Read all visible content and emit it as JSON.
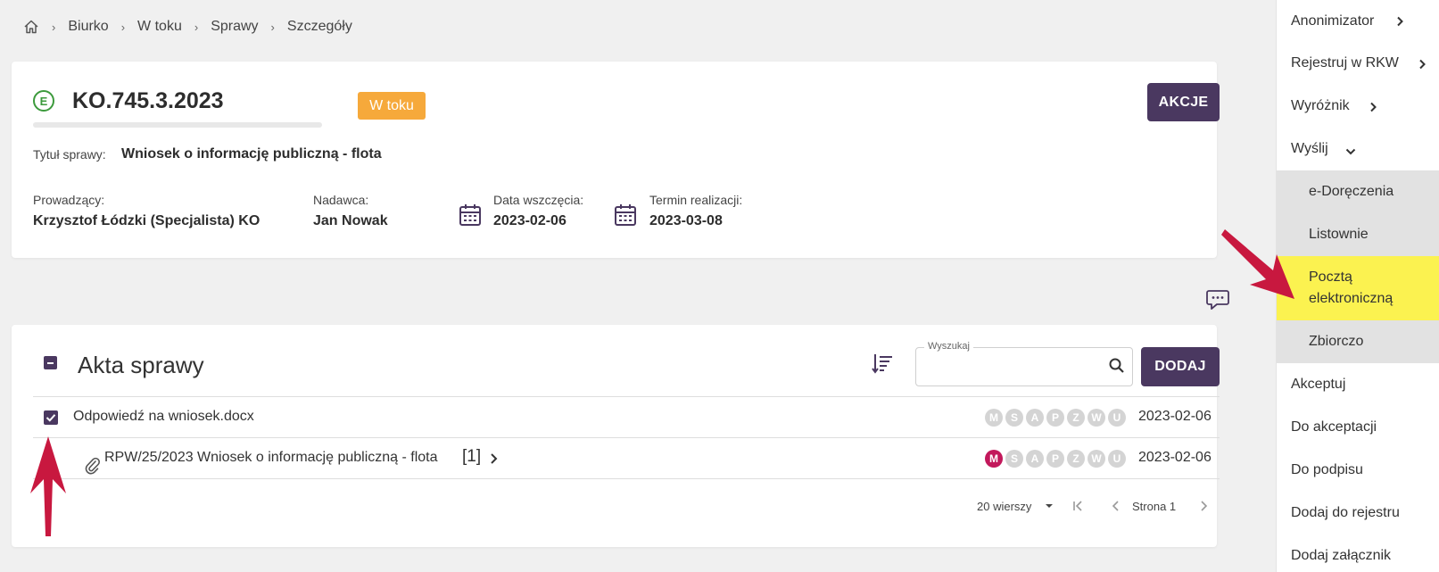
{
  "breadcrumb": {
    "items": [
      "Biurko",
      "W toku",
      "Sprawy",
      "Szczegóły"
    ]
  },
  "case": {
    "badge_letter": "E",
    "number": "KO.745.3.2023",
    "status": "W toku",
    "status_color": "#f6a93b",
    "actions_label": "AKCJE",
    "title_label": "Tytuł sprawy:",
    "title_value": "Wniosek o informację publiczną - flota",
    "fields": {
      "lead_label": "Prowadzący:",
      "lead_value": "Krzysztof Łódzki (Specjalista) KO",
      "sender_label": "Nadawca:",
      "sender_value": "Jan Nowak",
      "start_label": "Data wszczęcia:",
      "start_value": "2023-02-06",
      "deadline_label": "Termin realizacji:",
      "deadline_value": "2023-03-08"
    }
  },
  "akta": {
    "title": "Akta sprawy",
    "search_legend": "Wyszukaj",
    "search_value": "",
    "add_label": "DODAJ",
    "rows": [
      {
        "name": "Odpowiedź na wniosek.docx",
        "letters": [
          "M",
          "S",
          "A",
          "P",
          "Z",
          "W",
          "U"
        ],
        "date": "2023-02-06",
        "checked": true
      },
      {
        "name": "RPW/25/2023 Wniosek o informację publiczną - flota",
        "count": "[1]",
        "letters": [
          "M",
          "S",
          "A",
          "P",
          "Z",
          "W",
          "U"
        ],
        "active_letter": "M",
        "date": "2023-02-06"
      }
    ],
    "pager": {
      "rows_per_page": "20 wierszy",
      "page_label": "Strona 1"
    }
  },
  "sidebar": {
    "items": [
      {
        "label": "Anonimizator"
      },
      {
        "label": "Rejestruj w RKW"
      },
      {
        "label": "Wyróżnik"
      },
      {
        "label": "Wyślij"
      },
      {
        "label": "e-Doręczenia"
      },
      {
        "label": "Listownie"
      },
      {
        "label": "Pocztą elektroniczną"
      },
      {
        "label": "Zbiorczo"
      },
      {
        "label": "Akceptuj"
      },
      {
        "label": "Do akceptacji"
      },
      {
        "label": "Do podpisu"
      },
      {
        "label": "Dodaj do rejestru"
      },
      {
        "label": "Dodaj załącznik"
      }
    ],
    "highlight_color": "#fbf250"
  },
  "colors": {
    "primary": "#4a3860",
    "annotation_arrow": "#c8183f",
    "active_letter": "#c2185b"
  }
}
